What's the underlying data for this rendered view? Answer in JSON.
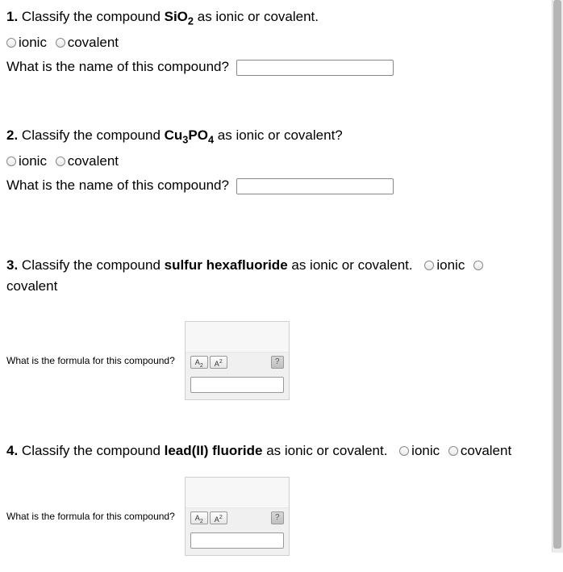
{
  "questions": [
    {
      "number": "1.",
      "prompt_before": "Classify the compound ",
      "compound_html": "SiO<sub>2</sub>",
      "prompt_after": " as ionic or covalent.",
      "option_ionic": "ionic",
      "option_covalent": "covalent",
      "sub_question": "What is the name of this compound?"
    },
    {
      "number": "2.",
      "prompt_before": "Classify the compound ",
      "compound_html": "Cu<sub>3</sub>PO<sub>4</sub>",
      "prompt_after": " as ionic or covalent?",
      "option_ionic": "ionic",
      "option_covalent": "covalent",
      "sub_question": "What is the name of this compound?"
    },
    {
      "number": "3.",
      "prompt_before": "Classify the compound ",
      "compound_text": "sulfur hexafluoride",
      "prompt_after": " as ionic or covalent.",
      "option_ionic": "ionic",
      "option_covalent": "covalent",
      "sub_question": "What is the formula for this compound?"
    },
    {
      "number": "4.",
      "prompt_before": "Classify the compound ",
      "compound_text": "lead(II) fluoride",
      "prompt_after": " as ionic or covalent.",
      "option_ionic": "ionic",
      "option_covalent": "covalent",
      "sub_question": "What is the formula for this compound?"
    }
  ],
  "toolbar": {
    "subscript_label": "A",
    "superscript_label": "A",
    "help_label": "?"
  }
}
